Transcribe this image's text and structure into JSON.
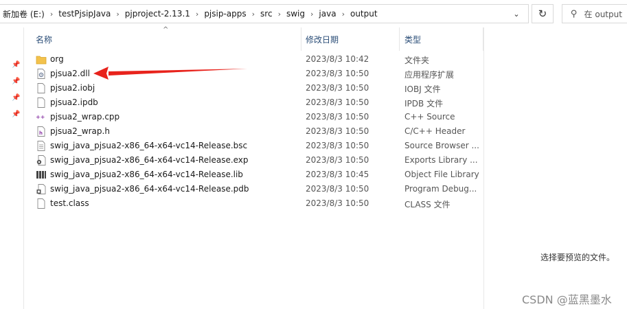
{
  "breadcrumb": [
    "新加卷 (E:)",
    "testPjsipJava",
    "pjproject-2.13.1",
    "pjsip-apps",
    "src",
    "swig",
    "java",
    "output"
  ],
  "search": {
    "placeholder": "在 output"
  },
  "columns": {
    "name": "名称",
    "date": "修改日期",
    "type": "类型"
  },
  "files": [
    {
      "name": "org",
      "date": "2023/8/3 10:42",
      "type": "文件夹",
      "icon": "folder-icon"
    },
    {
      "name": "pjsua2.dll",
      "date": "2023/8/3 10:50",
      "type": "应用程序扩展",
      "icon": "dll-file-icon"
    },
    {
      "name": "pjsua2.iobj",
      "date": "2023/8/3 10:50",
      "type": "IOBJ 文件",
      "icon": "generic-file-icon"
    },
    {
      "name": "pjsua2.ipdb",
      "date": "2023/8/3 10:50",
      "type": "IPDB 文件",
      "icon": "generic-file-icon"
    },
    {
      "name": "pjsua2_wrap.cpp",
      "date": "2023/8/3 10:50",
      "type": "C++ Source",
      "icon": "cpp-file-icon"
    },
    {
      "name": "pjsua2_wrap.h",
      "date": "2023/8/3 10:50",
      "type": "C/C++ Header",
      "icon": "header-file-icon"
    },
    {
      "name": "swig_java_pjsua2-x86_64-x64-vc14-Release.bsc",
      "date": "2023/8/3 10:50",
      "type": "Source Browser ...",
      "icon": "bsc-file-icon"
    },
    {
      "name": "swig_java_pjsua2-x86_64-x64-vc14-Release.exp",
      "date": "2023/8/3 10:50",
      "type": "Exports Library ...",
      "icon": "exp-file-icon"
    },
    {
      "name": "swig_java_pjsua2-x86_64-x64-vc14-Release.lib",
      "date": "2023/8/3 10:45",
      "type": "Object File Library",
      "icon": "lib-file-icon"
    },
    {
      "name": "swig_java_pjsua2-x86_64-x64-vc14-Release.pdb",
      "date": "2023/8/3 10:50",
      "type": "Program Debug...",
      "icon": "pdb-file-icon"
    },
    {
      "name": "test.class",
      "date": "2023/8/3 10:50",
      "type": "CLASS 文件",
      "icon": "generic-file-icon"
    }
  ],
  "preview": {
    "message": "选择要预览的文件。"
  },
  "watermark": "CSDN @蓝黑墨水",
  "colors": {
    "header_text": "#2a4d77",
    "folder": "#f3c24c",
    "arrow": "#e8231c",
    "pin": "#3a8ef0"
  }
}
